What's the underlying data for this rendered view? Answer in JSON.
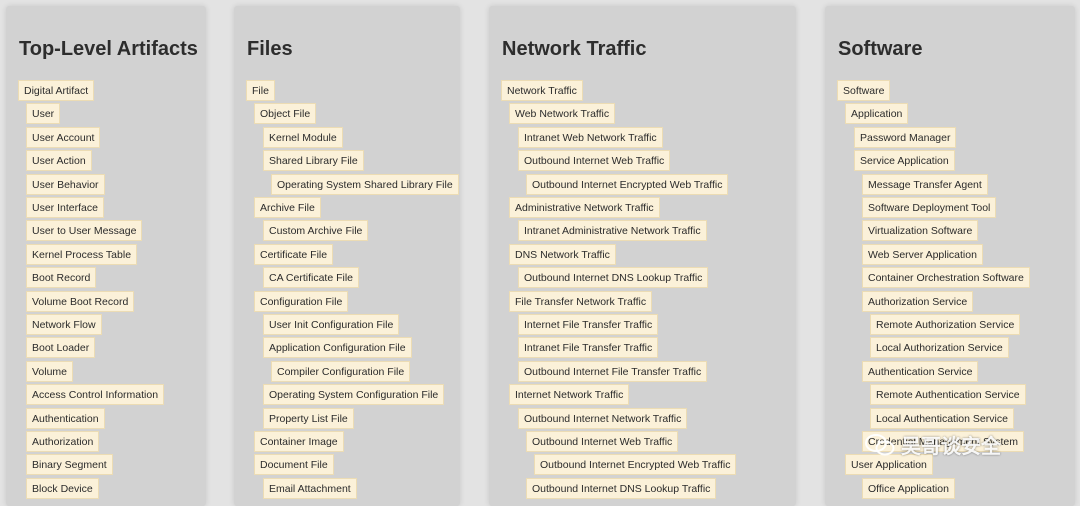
{
  "columns": [
    {
      "title": "Top-Level Artifacts",
      "items": [
        {
          "label": "Digital Artifact",
          "level": 0
        },
        {
          "label": "User",
          "level": 1
        },
        {
          "label": "User Account",
          "level": 1
        },
        {
          "label": "User Action",
          "level": 1
        },
        {
          "label": "User Behavior",
          "level": 1
        },
        {
          "label": "User Interface",
          "level": 1
        },
        {
          "label": "User to User Message",
          "level": 1
        },
        {
          "label": "Kernel Process Table",
          "level": 1
        },
        {
          "label": "Boot Record",
          "level": 1
        },
        {
          "label": "Volume Boot Record",
          "level": 1
        },
        {
          "label": "Network Flow",
          "level": 1
        },
        {
          "label": "Boot Loader",
          "level": 1
        },
        {
          "label": "Volume",
          "level": 1
        },
        {
          "label": "Access Control Information",
          "level": 1
        },
        {
          "label": "Authentication",
          "level": 1
        },
        {
          "label": "Authorization",
          "level": 1
        },
        {
          "label": "Binary Segment",
          "level": 1
        },
        {
          "label": "Block Device",
          "level": 1
        }
      ]
    },
    {
      "title": "Files",
      "items": [
        {
          "label": "File",
          "level": 0
        },
        {
          "label": "Object File",
          "level": 1
        },
        {
          "label": "Kernel Module",
          "level": 2
        },
        {
          "label": "Shared Library File",
          "level": 2
        },
        {
          "label": "Operating System Shared Library File",
          "level": 3
        },
        {
          "label": "Archive File",
          "level": 1
        },
        {
          "label": "Custom Archive File",
          "level": 2
        },
        {
          "label": "Certificate File",
          "level": 1
        },
        {
          "label": "CA Certificate File",
          "level": 2
        },
        {
          "label": "Configuration File",
          "level": 1
        },
        {
          "label": "User Init Configuration File",
          "level": 2
        },
        {
          "label": "Application Configuration File",
          "level": 2
        },
        {
          "label": "Compiler Configuration File",
          "level": 3
        },
        {
          "label": "Operating System Configuration File",
          "level": 2
        },
        {
          "label": "Property List File",
          "level": 2
        },
        {
          "label": "Container Image",
          "level": 1
        },
        {
          "label": "Document File",
          "level": 1
        },
        {
          "label": "Email Attachment",
          "level": 2
        }
      ]
    },
    {
      "title": "Network Traffic",
      "items": [
        {
          "label": "Network Traffic",
          "level": 0
        },
        {
          "label": "Web Network Traffic",
          "level": 1
        },
        {
          "label": "Intranet Web Network Traffic",
          "level": 2
        },
        {
          "label": "Outbound Internet Web Traffic",
          "level": 2
        },
        {
          "label": "Outbound Internet Encrypted Web Traffic",
          "level": 3
        },
        {
          "label": "Administrative Network Traffic",
          "level": 1
        },
        {
          "label": "Intranet Administrative Network Traffic",
          "level": 2
        },
        {
          "label": "DNS Network Traffic",
          "level": 1
        },
        {
          "label": "Outbound Internet DNS Lookup Traffic",
          "level": 2
        },
        {
          "label": "File Transfer Network Traffic",
          "level": 1
        },
        {
          "label": "Internet File Transfer Traffic",
          "level": 2
        },
        {
          "label": "Intranet File Transfer Traffic",
          "level": 2
        },
        {
          "label": "Outbound Internet File Transfer Traffic",
          "level": 2
        },
        {
          "label": "Internet Network Traffic",
          "level": 1
        },
        {
          "label": "Outbound Internet Network Traffic",
          "level": 2
        },
        {
          "label": "Outbound Internet Web Traffic",
          "level": 3
        },
        {
          "label": "Outbound Internet Encrypted Web Traffic",
          "level": 4
        },
        {
          "label": "Outbound Internet DNS Lookup Traffic",
          "level": 3
        }
      ]
    },
    {
      "title": "Software",
      "items": [
        {
          "label": "Software",
          "level": 0
        },
        {
          "label": "Application",
          "level": 1
        },
        {
          "label": "Password Manager",
          "level": 2
        },
        {
          "label": "Service Application",
          "level": 2
        },
        {
          "label": "Message Transfer Agent",
          "level": 3
        },
        {
          "label": "Software Deployment Tool",
          "level": 3
        },
        {
          "label": "Virtualization Software",
          "level": 3
        },
        {
          "label": "Web Server Application",
          "level": 3
        },
        {
          "label": "Container Orchestration Software",
          "level": 3
        },
        {
          "label": "Authorization Service",
          "level": 3
        },
        {
          "label": "Remote Authorization Service",
          "level": 4
        },
        {
          "label": "Local Authorization Service",
          "level": 4
        },
        {
          "label": "Authentication Service",
          "level": 3
        },
        {
          "label": "Remote Authentication Service",
          "level": 4
        },
        {
          "label": "Local Authentication Service",
          "level": 4
        },
        {
          "label": "Credential Management System",
          "level": 3
        },
        {
          "label": "User Application",
          "level": 1
        },
        {
          "label": "Office Application",
          "level": 3
        }
      ]
    }
  ],
  "watermark": {
    "text": "吴哥谈安全",
    "icon": "wechat-icon"
  },
  "colors": {
    "page": "#e3e3e3",
    "panel": "#d2d2d2",
    "chip": "#fbf1d9",
    "chip_border": "#ecdcb4",
    "title": "#2d2d2d"
  }
}
